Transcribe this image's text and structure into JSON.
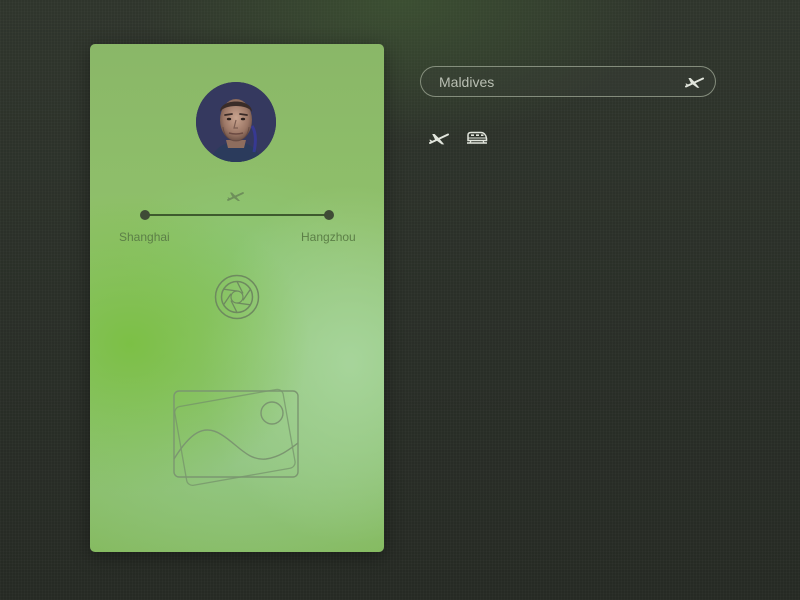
{
  "trip": {
    "origin": "Shanghai",
    "destination": "Hangzhou"
  },
  "search": {
    "value": "Maldives",
    "placeholder": ""
  },
  "icons": {
    "route": "airplane-icon",
    "camera": "camera-aperture-icon",
    "photo": "image-gallery-icon",
    "search_submit": "airplane-icon",
    "mode_flight": "airplane-icon",
    "mode_train": "train-icon"
  },
  "colors": {
    "background": "#2b3029",
    "card_green": "#8fc06a",
    "route_line": "#3e5a2e",
    "city_text": "#5c7f47",
    "search_border": "#afb9a5",
    "icon_light": "#e1e5dc"
  }
}
